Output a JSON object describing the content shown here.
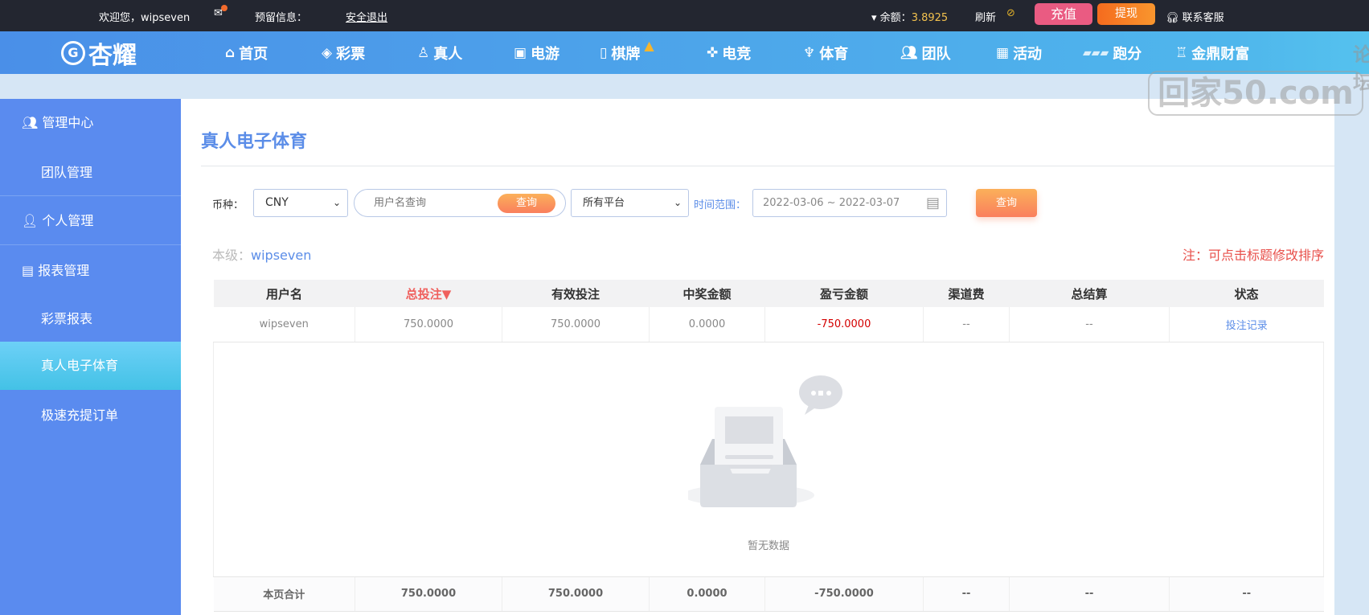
{
  "topbar": {
    "welcome": "欢迎您，wipseven",
    "reserved_info": "预留信息：",
    "logout": "安全退出",
    "balance_label": "余额：",
    "balance_value": "3.8925",
    "refresh": "刷新",
    "deposit": "充值",
    "withdraw": "提现",
    "support": "联系客服"
  },
  "logo": {
    "text": "杏耀"
  },
  "nav": [
    {
      "label": "首页",
      "icon": "home-icon"
    },
    {
      "label": "彩票",
      "icon": "ticket-icon"
    },
    {
      "label": "真人",
      "icon": "person-icon"
    },
    {
      "label": "电游",
      "icon": "slot-icon"
    },
    {
      "label": "棋牌",
      "icon": "cards-icon"
    },
    {
      "label": "电竞",
      "icon": "gamepad-icon"
    },
    {
      "label": "体育",
      "icon": "trophy-icon"
    },
    {
      "label": "团队",
      "icon": "team-icon"
    },
    {
      "label": "活动",
      "icon": "gift-icon"
    },
    {
      "label": "跑分",
      "icon": "rhino-icon"
    },
    {
      "label": "金鼎财富",
      "icon": "cauldron-icon"
    }
  ],
  "watermark": {
    "top": "论坛",
    "main": "回家50.com"
  },
  "sidebar": {
    "items": [
      {
        "label": "管理中心"
      },
      {
        "label": "团队管理"
      },
      {
        "label": "个人管理"
      },
      {
        "label": "报表管理"
      },
      {
        "label": "彩票报表"
      },
      {
        "label": "真人电子体育"
      },
      {
        "label": "极速充提订单"
      }
    ]
  },
  "page": {
    "title": "真人电子体育",
    "currency_label": "币种：",
    "currency_value": "CNY",
    "username_placeholder": "用户名查询",
    "username_search": "查询",
    "platform_value": "所有平台",
    "time_label": "时间范围：",
    "date_range": "2022-03-06 ~ 2022-03-07",
    "query": "查询",
    "level_label": "本级：",
    "level_user": "wipseven",
    "note": "注：可点击标题修改排序",
    "empty": "暂无数据"
  },
  "table": {
    "headers": [
      "用户名",
      "总投注▼",
      "有效投注",
      "中奖金额",
      "盈亏金额",
      "渠道费",
      "总结算",
      "状态"
    ],
    "row": [
      "wipseven",
      "750.0000",
      "750.0000",
      "0.0000",
      "-750.0000",
      "--",
      "--",
      "投注记录"
    ],
    "total": [
      "本页合计",
      "750.0000",
      "750.0000",
      "0.0000",
      "-750.0000",
      "--",
      "--",
      "--"
    ]
  },
  "colors": {
    "accent": "#5b8de8",
    "negative": "#d40000",
    "sorted_header": "#f0605d",
    "note": "#e8504b"
  }
}
